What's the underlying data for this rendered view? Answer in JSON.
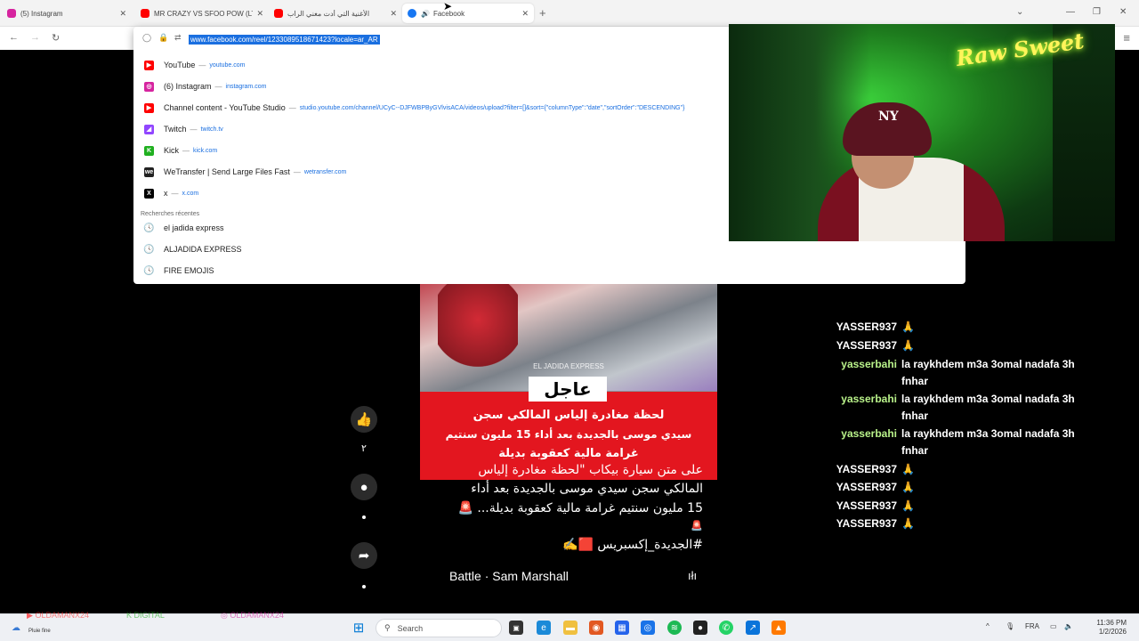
{
  "tabs": [
    {
      "label": "(5) Instagram",
      "fav_color": "#d6249f",
      "has_close": true
    },
    {
      "label": "MR CRAZY VS SFOO POW (LTD",
      "fav_color": "#ff0000",
      "has_close": true
    },
    {
      "label": "الأغنية التي أدت مغني الراب",
      "fav_color": "#ff0000",
      "has_close": true
    },
    {
      "label": "Facebook",
      "fav_color": "#1877f2",
      "has_close": true,
      "audio": "🔊"
    }
  ],
  "tab_close_glyph": "✕",
  "new_tab_glyph": "+",
  "address_url": "www.facebook.com/reel/1233089518671423?locale=ar_AR",
  "suggestions": [
    {
      "title": "YouTube",
      "url": "youtube.com",
      "icon": "youtube-icon",
      "color": "#ff0000",
      "glyph": "▶"
    },
    {
      "title": "(6) Instagram",
      "url": "instagram.com",
      "icon": "instagram-icon",
      "color": "#d6249f",
      "glyph": "◎"
    },
    {
      "title": "Channel content - YouTube Studio",
      "url": "studio.youtube.com/channel/UCyC--DJFWBPByGVlvisACA/videos/upload?filter=[]&sort={\"columnType\":\"date\",\"sortOrder\":\"DESCENDING\"}",
      "icon": "youtube-studio-icon",
      "color": "#ff0000",
      "glyph": "▶"
    },
    {
      "title": "Twitch",
      "url": "twitch.tv",
      "icon": "twitch-icon",
      "color": "#9146ff",
      "glyph": "◢"
    },
    {
      "title": "Kick",
      "url": "kick.com",
      "icon": "kick-icon",
      "color": "#20b020",
      "glyph": "K"
    },
    {
      "title": "WeTransfer | Send Large Files Fast",
      "url": "wetransfer.com",
      "icon": "wetransfer-icon",
      "color": "#222222",
      "glyph": "we"
    },
    {
      "title": "x",
      "url": "x.com",
      "icon": "x-icon",
      "color": "#000000",
      "glyph": "X"
    }
  ],
  "recent_header": "Recherches récentes",
  "recent": [
    {
      "title": "el jadida express"
    },
    {
      "title": "ALJADIDA EXPRESS"
    },
    {
      "title": "FIRE EMOJIS"
    }
  ],
  "webcam": {
    "neon_sign": "Raw Sweet",
    "cap_logo": "NY"
  },
  "video": {
    "watermark": "EL JADIDA EXPRESS",
    "badge": "عاجل",
    "lines": [
      "لحظة مغادرة إلياس المالكي سجن",
      "سيدي موسى بالجديدة بعد أداء 15 مليون سنتيم",
      "غرامة مالية كعقوبة بديلة"
    ]
  },
  "caption": {
    "lines": [
      "على متن سيارة بيكاب \"لحظة مغادرة إلياس",
      "المالكي سجن سيدي موسى بالجديدة بعد أداء",
      "15 مليون سنتيم غرامة مالية كعقوبة بديلة... 🚨",
      "🚨",
      "#الجديدة_إكسبريس 🟥✍️"
    ],
    "music": "Battle · Sam Marshall"
  },
  "actions": {
    "like_count": "٢",
    "like_glyph": "👍",
    "comment_glyph": "●",
    "share_glyph": "➦"
  },
  "chat": [
    {
      "user": "YASSER937",
      "text": "🙏",
      "color": "#ffffff"
    },
    {
      "user": "YASSER937",
      "text": "🙏",
      "color": "#ffffff"
    },
    {
      "user": "yasserbahi",
      "text": "la raykhdem m3a 3omal nadafa 3h fnhar",
      "color": "#b9f28a"
    },
    {
      "user": "yasserbahi",
      "text": "la raykhdem m3a 3omal nadafa 3h fnhar",
      "color": "#b9f28a"
    },
    {
      "user": "yasserbahi",
      "text": "la raykhdem m3a 3omal nadafa 3h fnhar",
      "color": "#b9f28a"
    },
    {
      "user": "YASSER937",
      "text": "🙏",
      "color": "#ffffff"
    },
    {
      "user": "YASSER937",
      "text": "🙏",
      "color": "#ffffff"
    },
    {
      "user": "YASSER937",
      "text": "🙏",
      "color": "#ffffff"
    },
    {
      "user": "YASSER937",
      "text": "🙏",
      "color": "#ffffff"
    }
  ],
  "taskbar": {
    "weather": "Pluie fine",
    "search_placeholder": "Search",
    "lang": "FRA",
    "time": "11:36 PM",
    "date": "1/2/2026",
    "overlay_names": [
      "OLDAMANX24",
      "DIGITAL",
      "OLDAMANX24"
    ]
  }
}
